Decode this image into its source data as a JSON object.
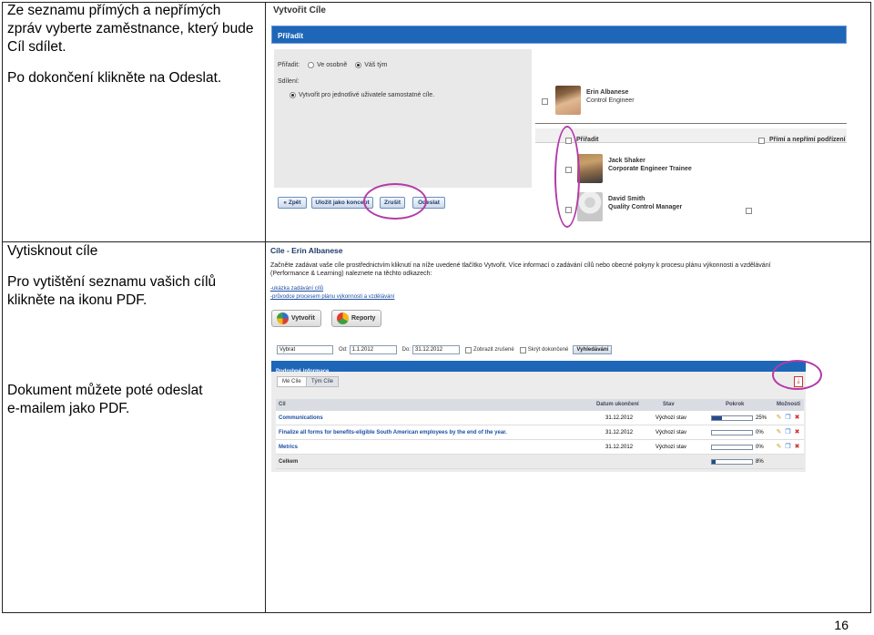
{
  "left_column": {
    "block1_lines": [
      "Ze seznamu přímých a nepřímých",
      "zpráv vyberte zaměstnance, který bude",
      "Cíl sdílet."
    ],
    "block2": "Po dokončení klikněte na Odeslat.",
    "block3_heading": "Vytisknout cíle",
    "block3_lines": [
      "Pro vytištění seznamu vašich cílů",
      "klikněte na ikonu PDF."
    ],
    "block4_lines": [
      "Dokument můžete poté odeslat",
      "e-mailem jako PDF."
    ]
  },
  "page_number": "16",
  "screen1": {
    "title": "Vytvořit Cíle",
    "section_bar": "Přiřadit",
    "assign_label": "Přiřadit:",
    "assign_options": [
      "Ve osobně",
      "Váš tým"
    ],
    "assign_selected": "Váš tým",
    "share_label": "Sdílení:",
    "share_option": "Vytvořit pro jednotlivé uživatele samostatné cíle.",
    "first_person": {
      "name": "Erin Albanese",
      "role": "Control Engineer"
    },
    "directory_header_left": "Přiřadit",
    "directory_header_right": "Přímí a nepřímí podřízení",
    "people": [
      {
        "name": "Jack Shaker",
        "role": "Corporate Engineer Trainee"
      },
      {
        "name": "David   Smith",
        "role": "Quality Control Manager"
      }
    ],
    "buttons": [
      "« Zpět",
      "Uložit jako koncept",
      "Zrušit",
      "Odeslat"
    ],
    "highlight_color": "#b53aa8"
  },
  "screen2": {
    "title": "Cíle - Erin Albanese",
    "description": "Začněte zadávat vaše cíle prostřednictvím kliknutí na níže uvedené tlačítko Vytvořit. Více informací o zadávání cílů nebo obecné pokyny k procesu plánu výkonnosti a vzdělávání (Performance & Learning) naleznete na těchto odkazech:",
    "links": [
      "-ukázka zadávání cílů",
      "-průvodce procesem plánu výkonnosti a vzdělávání"
    ],
    "buttons": [
      "Vytvořit",
      "Reporty"
    ],
    "filter": {
      "select_value": "Vybrat",
      "from_label": "Od:",
      "from_value": "1.1.2012",
      "to_label": "Do:",
      "to_value": "31.12.2012",
      "show_completed": "Zobrazit zrušené",
      "hide_completed": "Skrýt dokončené",
      "search_button": "Vyhledávání"
    },
    "details_bar": "Podrobné informace",
    "tabs": [
      "Mé Cíle",
      "Tým Cíle"
    ],
    "columns": [
      "Cíl",
      "Datum ukončení",
      "Stav",
      "Pokrok",
      "Možnosti"
    ],
    "rows": [
      {
        "name": "Communications",
        "date": "31.12.2012",
        "status": "Výchozí stav",
        "progress_pct": 25,
        "progress_label": "25%"
      },
      {
        "name": "Finalize all forms for benefits-eligible South American employees by the end of the year.",
        "date": "31.12.2012",
        "status": "Výchozí stav",
        "progress_pct": 0,
        "progress_label": "0%"
      },
      {
        "name": "Metrics",
        "date": "31.12.2012",
        "status": "Výchozí stav",
        "progress_pct": 0,
        "progress_label": "0%"
      }
    ],
    "total": {
      "label": "Celkem",
      "progress_pct": 8,
      "progress_label": "8%"
    }
  }
}
